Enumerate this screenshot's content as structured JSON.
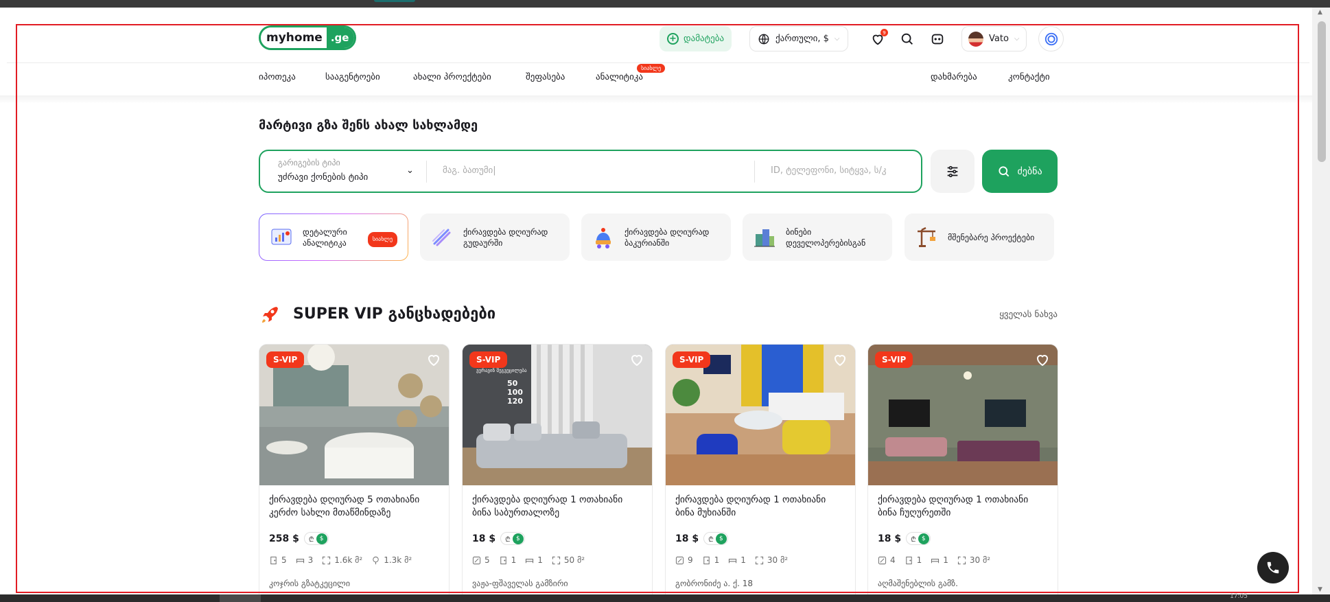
{
  "header": {
    "logo_part1": "myhome",
    "logo_part2": ".ge",
    "add_button": "დამატება",
    "language": "ქართული, $",
    "favorites_count": "9",
    "user_name": "Vato"
  },
  "nav": {
    "items": [
      "იპოთეკა",
      "სააგენტოები",
      "ახალი პროექტები",
      "შეფასება",
      "ანალიტიკა"
    ],
    "analytics_badge": "სიახლე",
    "right_items": [
      "დახმარება",
      "კონტაქტი"
    ]
  },
  "hero": {
    "title": "მარტივი გზა შენს ახალ სახლამდე",
    "property_type_label": "გარიგების ტიპი",
    "property_type_value": "უძრავი ქონების ტიპი",
    "location_placeholder": "მაგ. ბათუმი|",
    "id_placeholder": "ID, ტელეფონი, სიტყვა, ს/კ",
    "search_button": "ძებნა"
  },
  "quick_links": [
    {
      "label_line1": "დეტალური",
      "label_line2": "ანალიტიკა",
      "badge": "სიახლე",
      "icon": "analytics-icon"
    },
    {
      "label_line1": "ქირავდება დღიურად",
      "label_line2": "გუდაურში",
      "icon": "ski-icon"
    },
    {
      "label_line1": "ქირავდება დღიურად",
      "label_line2": "ბაკურიანში",
      "icon": "winter-hat-icon"
    },
    {
      "label_line1": "ბინები",
      "label_line2": "დეველოპერებისგან",
      "icon": "buildings-icon"
    },
    {
      "label_line1": "მშენებარე პროექტები",
      "label_line2": "",
      "icon": "crane-icon"
    }
  ],
  "super_vip": {
    "title": "SUPER VIP განცხადებები",
    "see_all": "ყველას ნახვა",
    "badge": "S-VIP"
  },
  "cards": [
    {
      "title": "ქირავდება დღიურად 5 ოთახიანი კერძო სახლი მთაწმინდაზე",
      "price": "258 $",
      "specs": [
        "5",
        "3",
        "1.6k მ²",
        "1.3k მ²"
      ],
      "address": "კოჯრის გზატკეცილი"
    },
    {
      "title": "ქირავდება დღიურად 1 ოთახიანი ბინა საბურთალოზე",
      "price": "18 $",
      "specs": [
        "5",
        "1",
        "1",
        "50 მ²"
      ],
      "address": "ვაჟა-ფშაველას გამზირი"
    },
    {
      "title": "ქირავდება დღიურად 1 ოთახიანი ბინა მუხიანში",
      "price": "18 $",
      "specs": [
        "9",
        "1",
        "1",
        "30 მ²"
      ],
      "address": "გობრონიძე ა. ქ. 18"
    },
    {
      "title": "ქირავდება დღიურად 1 ოთახიანი ბინა ჩუღურეთში",
      "price": "18 $",
      "specs": [
        "4",
        "1",
        "1",
        "30 მ²"
      ],
      "address": "აღმაშენებლის გამზ."
    }
  ],
  "currency_toggle": {
    "gel": "₾",
    "usd": "$"
  },
  "photo_tags": {
    "card2_sign": "ვერავინ შეგვეცილება",
    "card2_numbers": [
      "50",
      "100",
      "120"
    ]
  },
  "taskbar_clock": "17:05",
  "colors": {
    "brand_green": "#1ea25e",
    "badge_red": "#f2371b",
    "frame_red": "#e21b23"
  }
}
